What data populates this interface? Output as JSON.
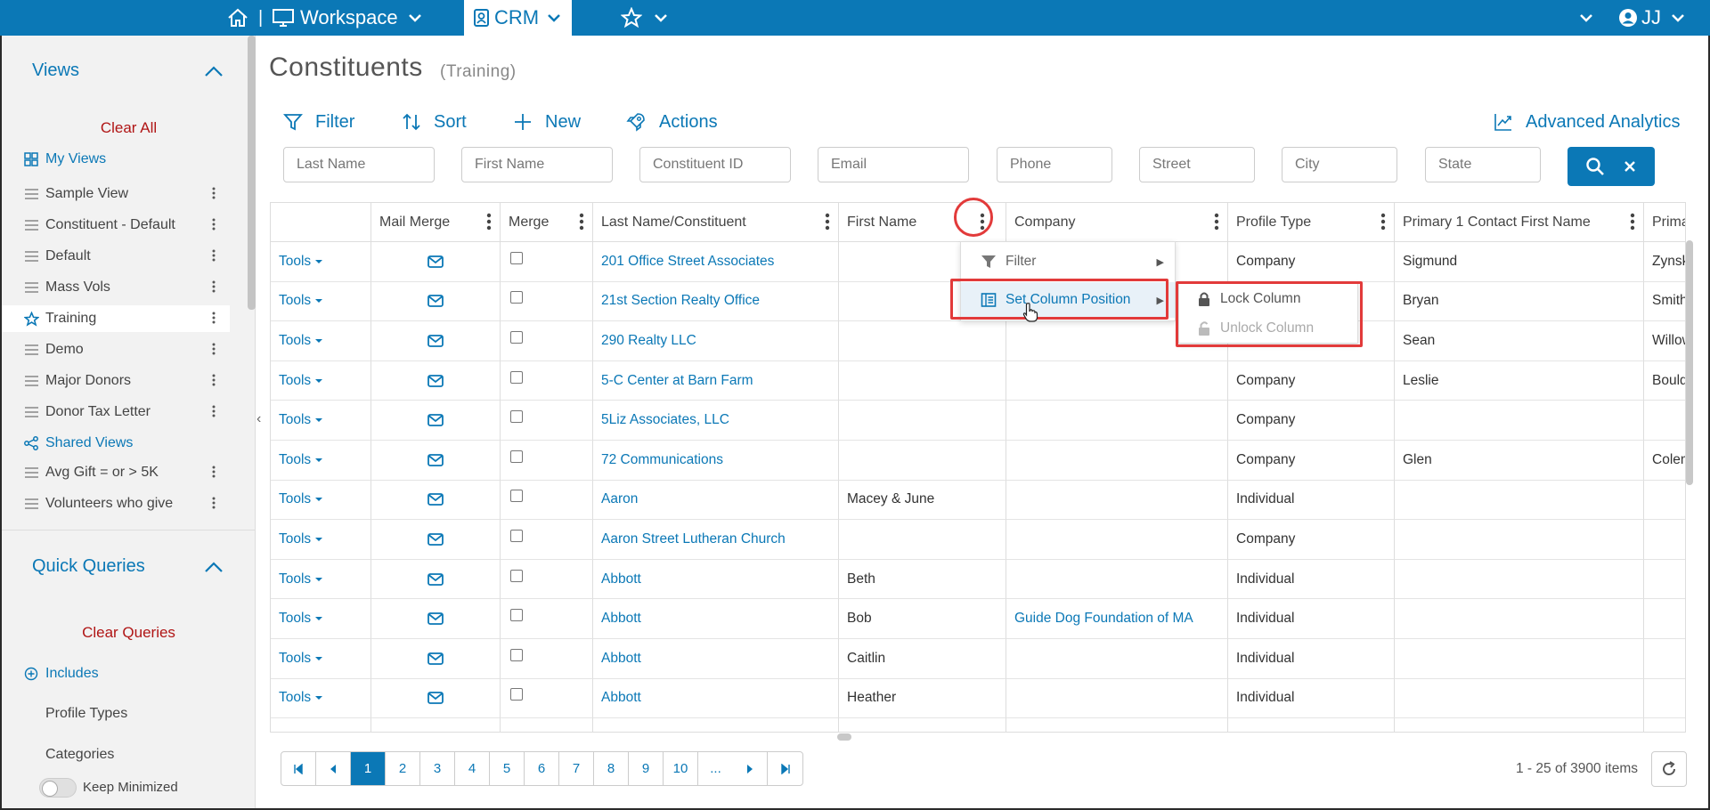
{
  "topbar": {
    "sep": "|",
    "workspace_label": "Workspace",
    "crm_label": "CRM",
    "user_initials": "JJ"
  },
  "sidebar": {
    "views_title": "Views",
    "clear_all": "Clear All",
    "my_views": "My Views",
    "items": [
      {
        "label": "Sample View"
      },
      {
        "label": "Constituent - Default"
      },
      {
        "label": "Default"
      },
      {
        "label": "Mass Vols"
      },
      {
        "label": "Training"
      },
      {
        "label": "Demo"
      },
      {
        "label": "Major Donors"
      },
      {
        "label": "Donor Tax Letter"
      }
    ],
    "shared_views": "Shared Views",
    "shared_items": [
      {
        "label": "Avg Gift = or > 5K"
      },
      {
        "label": "Volunteers who give"
      }
    ],
    "quick_queries_title": "Quick Queries",
    "clear_queries": "Clear Queries",
    "includes": "Includes",
    "profile_types": "Profile Types",
    "categories": "Categories",
    "keep_minimized": "Keep Minimized"
  },
  "page": {
    "title": "Constituents",
    "subtitle": "(Training)"
  },
  "toolbar": {
    "filter": "Filter",
    "sort": "Sort",
    "new": "New",
    "actions": "Actions",
    "analytics": "Advanced Analytics"
  },
  "filters": {
    "last_name": "Last Name",
    "first_name": "First Name",
    "constituent_id": "Constituent ID",
    "email": "Email",
    "phone": "Phone",
    "street": "Street",
    "city": "City",
    "state": "State"
  },
  "grid": {
    "headers": {
      "mail_merge": "Mail Merge",
      "merge": "Merge",
      "last_name": "Last Name/Constituent",
      "first_name": "First Name",
      "company": "Company",
      "profile_type": "Profile Type",
      "primary_contact": "Primary 1 Contact First Name",
      "primary_last": "Prima"
    },
    "tools_label": "Tools",
    "rows": [
      {
        "last": "201 Office Street Associates",
        "first": "",
        "company": "",
        "profile": "Company",
        "contact": "Sigmund",
        "plast": "Zynski"
      },
      {
        "last": "21st Section Realty Office",
        "first": "",
        "company": "",
        "profile": "",
        "contact": "Bryan",
        "plast": "Smith"
      },
      {
        "last": "290 Realty LLC",
        "first": "",
        "company": "",
        "profile": "",
        "contact": "Sean",
        "plast": "Willow"
      },
      {
        "last": "5-C Center at Barn Farm",
        "first": "",
        "company": "",
        "profile": "Company",
        "contact": "Leslie",
        "plast": "Boulde"
      },
      {
        "last": "5Liz Associates, LLC",
        "first": "",
        "company": "",
        "profile": "Company",
        "contact": "",
        "plast": ""
      },
      {
        "last": "72 Communications",
        "first": "",
        "company": "",
        "profile": "Company",
        "contact": "Glen",
        "plast": "Colem"
      },
      {
        "last": "Aaron",
        "first": "Macey & June",
        "company": "",
        "profile": "Individual",
        "contact": "",
        "plast": ""
      },
      {
        "last": "Aaron Street Lutheran Church",
        "first": "",
        "company": "",
        "profile": "Company",
        "contact": "",
        "plast": ""
      },
      {
        "last": "Abbott",
        "first": "Beth",
        "company": "",
        "profile": "Individual",
        "contact": "",
        "plast": ""
      },
      {
        "last": "Abbott",
        "first": "Bob",
        "company": "Guide Dog Foundation of MA",
        "profile": "Individual",
        "contact": "",
        "plast": ""
      },
      {
        "last": "Abbott",
        "first": "Caitlin",
        "company": "",
        "profile": "Individual",
        "contact": "",
        "plast": ""
      },
      {
        "last": "Abbott",
        "first": "Heather",
        "company": "",
        "profile": "Individual",
        "contact": "",
        "plast": ""
      }
    ]
  },
  "column_menu": {
    "filter": "Filter",
    "set_column_position": "Set Column Position",
    "lock_column": "Lock Column",
    "unlock_column": "Unlock Column"
  },
  "pager": {
    "pages": [
      "1",
      "2",
      "3",
      "4",
      "5",
      "6",
      "7",
      "8",
      "9",
      "10",
      "..."
    ],
    "items_info": "1 - 25 of 3900 items"
  },
  "colors": {
    "brand": "#0b78b6",
    "danger": "#b01515",
    "highlight": "#e23a3a"
  }
}
